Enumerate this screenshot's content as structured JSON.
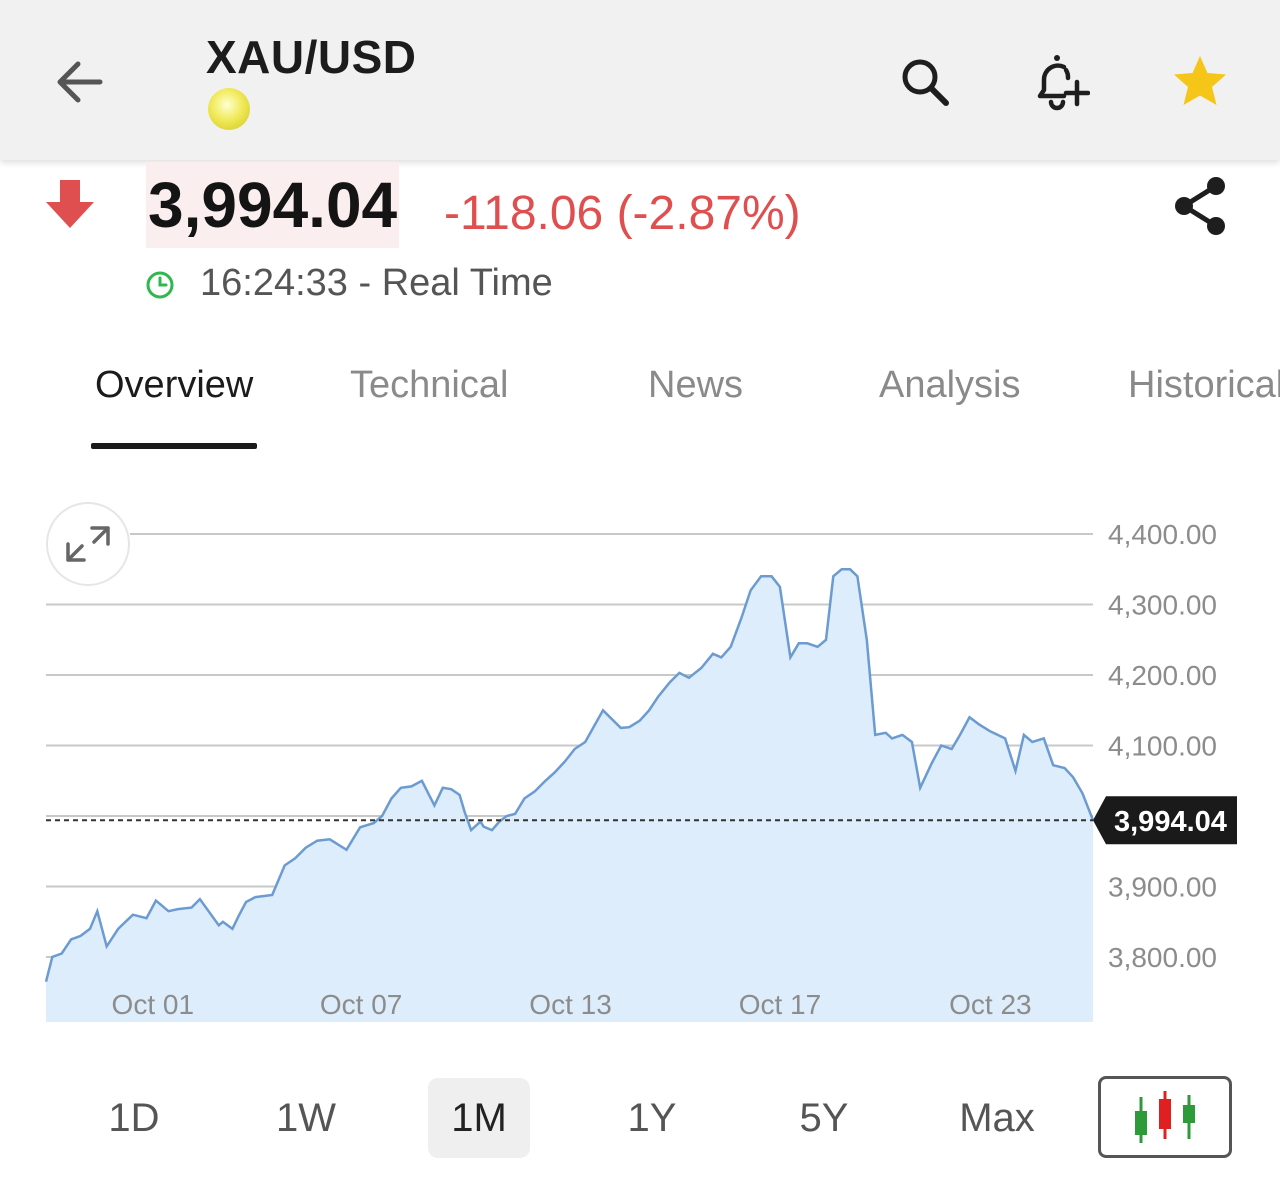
{
  "header": {
    "title": "XAU/USD",
    "icons": {
      "back": "arrow-left-icon",
      "search": "search-icon",
      "alert": "bell-plus-icon",
      "favorite": "star-icon"
    },
    "favorite_color": "#f5c518"
  },
  "quote": {
    "price": "3,994.04",
    "change": "-118.06 (-2.87%)",
    "direction": "down",
    "time": "16:24:33 - Real Time",
    "down_color": "#e04f4f",
    "clock_color": "#2fb84e"
  },
  "tabs": [
    {
      "label": "Overview",
      "active": true
    },
    {
      "label": "Technical",
      "active": false
    },
    {
      "label": "News",
      "active": false
    },
    {
      "label": "Analysis",
      "active": false
    },
    {
      "label": "Historical",
      "active": false
    }
  ],
  "ranges": [
    {
      "label": "1D",
      "active": false
    },
    {
      "label": "1W",
      "active": false
    },
    {
      "label": "1M",
      "active": true
    },
    {
      "label": "1Y",
      "active": false
    },
    {
      "label": "5Y",
      "active": false
    },
    {
      "label": "Max",
      "active": false
    }
  ],
  "chart_data": {
    "type": "area",
    "title": "",
    "xlabel": "",
    "ylabel": "",
    "ylim": [
      3765,
      4435
    ],
    "y_ticks": [
      3800,
      3900,
      4000,
      4100,
      4200,
      4300,
      4400
    ],
    "y_tick_labels": [
      "3,800.00",
      "3,900.00",
      "4,000.00",
      "4,100.00",
      "4,200.00",
      "4,300.00",
      "4,400.00"
    ],
    "x_tick_labels": [
      "Oct 01",
      "Oct 07",
      "Oct 13",
      "Oct 17",
      "Oct 23"
    ],
    "x_tick_positions": [
      10.2,
      30.1,
      50.1,
      70.1,
      90.2
    ],
    "current_value": 3994.04,
    "current_label": "3,994.04",
    "grid": true,
    "line_color": "#6b9bd1",
    "fill_color": "#deedfb",
    "series": [
      {
        "x": [
          0,
          0.6,
          1.5,
          2.4,
          3.3,
          4.2,
          4.9,
          5.8,
          6.9,
          8.3,
          9.6,
          10.5,
          11.7,
          12.6,
          13.9,
          14.7,
          16.5,
          16.9,
          17.8,
          18.4,
          19.1,
          20,
          21.6,
          22.8,
          23.8,
          24.8,
          25.9,
          27.1,
          28.7,
          30,
          31.3,
          32.1,
          33,
          33.9,
          34.9,
          35.9,
          37.1,
          37.9,
          38.7,
          39.5,
          40,
          40.6,
          41.5,
          41.8,
          42.6,
          43.3,
          44,
          44.8,
          45.7,
          46.7,
          47.7,
          48.6,
          49.6,
          50.5,
          51.5,
          53.2,
          54.9,
          55.7,
          56.7,
          57.6,
          58.5,
          59.6,
          60.5,
          61.4,
          62.6,
          63.7,
          64.5,
          65.4,
          66.4,
          67.3,
          68.3,
          69.3,
          70.1,
          71.1,
          71.9,
          72.7,
          73.7,
          74.5,
          75.2,
          76,
          76.8,
          77.5,
          78.4,
          79.2,
          80.2,
          80.8,
          81.8,
          82.7,
          83.5,
          84.6,
          85.5,
          86.5,
          87.3,
          88.2,
          89.1,
          90.2,
          91.6,
          92.6,
          93.4,
          94.2,
          95.3,
          96.2,
          97.3,
          98.1,
          99,
          100
        ],
        "y": [
          3765,
          3800,
          3805,
          3825,
          3830,
          3840,
          3865,
          3815,
          3840,
          3860,
          3855,
          3880,
          3865,
          3868,
          3870,
          3882,
          3845,
          3850,
          3840,
          3858,
          3878,
          3885,
          3888,
          3930,
          3940,
          3955,
          3965,
          3967,
          3952,
          3984,
          3990,
          4000,
          4025,
          4040,
          4042,
          4050,
          4015,
          4040,
          4038,
          4030,
          4005,
          3980,
          3992,
          3985,
          3980,
          3992,
          4000,
          4003,
          4025,
          4035,
          4050,
          4062,
          4078,
          4095,
          4105,
          4150,
          4125,
          4126,
          4135,
          4150,
          4170,
          4190,
          4203,
          4196,
          4210,
          4230,
          4225,
          4240,
          4280,
          4320,
          4340,
          4340,
          4325,
          4225,
          4245,
          4245,
          4240,
          4250,
          4340,
          4350,
          4350,
          4340,
          4250,
          4115,
          4118,
          4110,
          4115,
          4105,
          4040,
          4075,
          4100,
          4095,
          4115,
          4140,
          4130,
          4120,
          4110,
          4064,
          4115,
          4105,
          4110,
          4072,
          4068,
          4055,
          4032,
          3994.04
        ]
      }
    ]
  }
}
